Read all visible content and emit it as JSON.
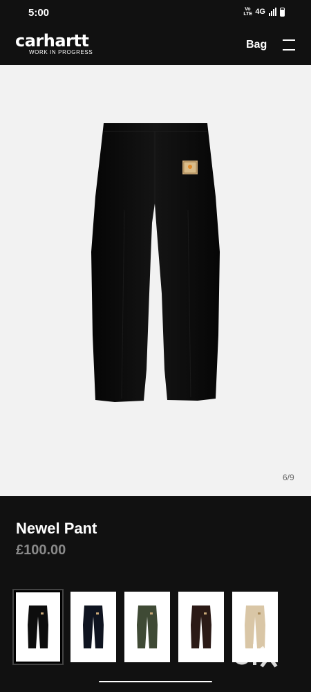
{
  "status_bar": {
    "time": "5:00",
    "volte": "VoLTE",
    "network": "4G"
  },
  "header": {
    "logo_word": "carhartt",
    "logo_sub": "WORK IN PROGRESS",
    "bag_label": "Bag",
    "menu_icon": "hamburger-menu-icon"
  },
  "gallery": {
    "counter": "6/9",
    "main_colour": "#0d0d0d",
    "background": "#f2f2f2"
  },
  "product": {
    "name": "Newel Pant",
    "price": "£100.00"
  },
  "thumbnails": [
    {
      "colour": "#0d0d0d",
      "selected": true
    },
    {
      "colour": "#0f1420",
      "selected": false
    },
    {
      "colour": "#3f4a35",
      "selected": false
    },
    {
      "colour": "#2b1a16",
      "selected": false
    },
    {
      "colour": "#d9c6a6",
      "selected": false
    }
  ],
  "watermark": {
    "text": "olx"
  }
}
